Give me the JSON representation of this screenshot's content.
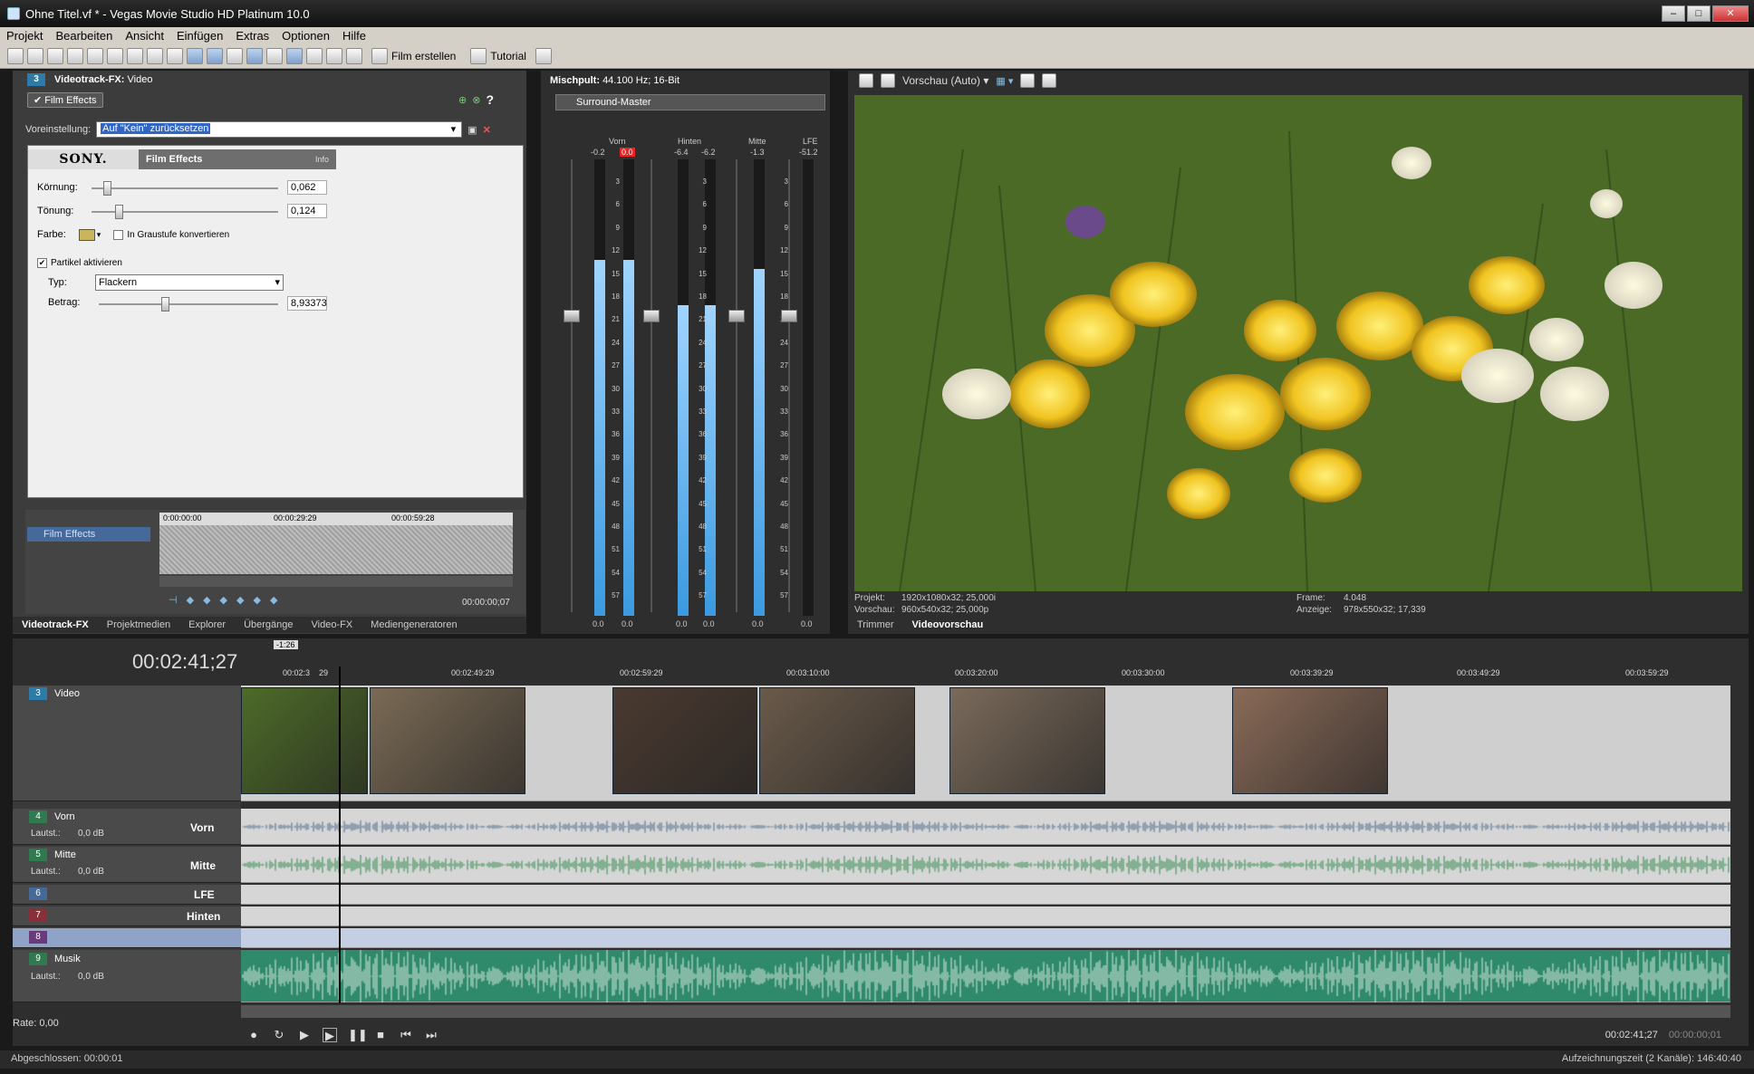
{
  "window": {
    "title": "Ohne Titel.vf * - Vegas Movie Studio HD Platinum 10.0"
  },
  "menu": [
    "Projekt",
    "Bearbeiten",
    "Ansicht",
    "Einfügen",
    "Extras",
    "Optionen",
    "Hilfe"
  ],
  "toolbar": {
    "film_erstellen": "Film erstellen",
    "tutorial": "Tutorial"
  },
  "fx_panel": {
    "track_number": "3",
    "title": "Videotrack-FX:",
    "title_sub": "Video",
    "chain_item": "Film Effects",
    "preset_label": "Voreinstellung:",
    "preset_value": "Auf \"Kein\" zurücksetzen",
    "plugin_logo": "SONY.",
    "plugin_name": "Film Effects",
    "plugin_info": "Info",
    "koernung_label": "Körnung:",
    "koernung_value": "0,062",
    "koernung_level": 0.062,
    "toenung_label": "Tönung:",
    "toenung_value": "0,124",
    "toenung_level": 0.124,
    "farbe_label": "Farbe:",
    "graustufe_label": "In Graustufe konvertieren",
    "partikel_label": "Partikel aktivieren",
    "typ_label": "Typ:",
    "typ_value": "Flackern",
    "betrag_label": "Betrag:",
    "betrag_value": "8,93373",
    "betrag_level": 0.35,
    "kf_row": "Film Effects",
    "kf_ruler": [
      "0:00:00:00",
      "00:00:29:29",
      "00:00:59:28"
    ],
    "kf_time": "00:00:00;07"
  },
  "left_tabs": [
    "Videotrack-FX",
    "Projektmedien",
    "Explorer",
    "Übergänge",
    "Video-FX",
    "Mediengeneratoren"
  ],
  "mixer": {
    "title": "Mischpult:",
    "format": "44.100 Hz; 16-Bit",
    "bus": "Surround-Master",
    "groups": [
      "Vorn",
      "Hinten",
      "Mitte",
      "LFE"
    ],
    "peaks": [
      "-0.2",
      "0.0",
      "-6.4",
      "-6.2",
      "-1.3",
      "-51.2"
    ],
    "scale": [
      "3",
      "6",
      "9",
      "12",
      "15",
      "18",
      "21",
      "24",
      "27",
      "30",
      "33",
      "36",
      "39",
      "42",
      "45",
      "48",
      "51",
      "54",
      "57"
    ],
    "bottom_values": [
      "0.0",
      "0.0",
      "0.0",
      "0.0",
      "0.0",
      "0.0"
    ]
  },
  "preview": {
    "mode": "Vorschau (Auto)",
    "projekt_label": "Projekt:",
    "projekt_value": "1920x1080x32; 25,000i",
    "vorschau_label": "Vorschau:",
    "vorschau_value": "960x540x32; 25,000p",
    "frame_label": "Frame:",
    "frame_value": "4.048",
    "anzeige_label": "Anzeige:",
    "anzeige_value": "978x550x32; 17,339",
    "tabs": [
      "Trimmer",
      "Videovorschau"
    ]
  },
  "timeline": {
    "counter": "00:02:41;27",
    "marker": "-1:26",
    "ruler": [
      "00:02:3",
      "29",
      "00:02:49:29",
      "00:02:59:29",
      "00:03:10:00",
      "00:03:20:00",
      "00:03:30:00",
      "00:03:39:29",
      "00:03:49:29",
      "00:03:59:29"
    ],
    "tracks": [
      {
        "num": "3",
        "name": "Video"
      },
      {
        "num": "4",
        "name": "Vorn",
        "big": "Vorn",
        "sub": "Lautst.:",
        "db": "0,0 dB"
      },
      {
        "num": "5",
        "name": "Mitte",
        "big": "Mitte",
        "sub": "Lautst.:",
        "db": "0,0 dB"
      },
      {
        "num": "6",
        "big": "LFE"
      },
      {
        "num": "7",
        "big": "Hinten"
      },
      {
        "num": "8"
      },
      {
        "num": "9",
        "name": "Musik",
        "sub": "Lautst.:",
        "db": "0,0 dB"
      }
    ],
    "rate": "Rate: 0,00",
    "end_time": "00:02:41;27",
    "end_time2": "00:00:00;01"
  },
  "status": {
    "left": "Abgeschlossen: 00:00:01",
    "right": "Aufzeichnungszeit (2 Kanäle): 146:40:40"
  },
  "colors": {
    "video_track": "#2e7ba8",
    "meter": "#3b9ae0",
    "audio_wave": "#2e8a6a"
  }
}
